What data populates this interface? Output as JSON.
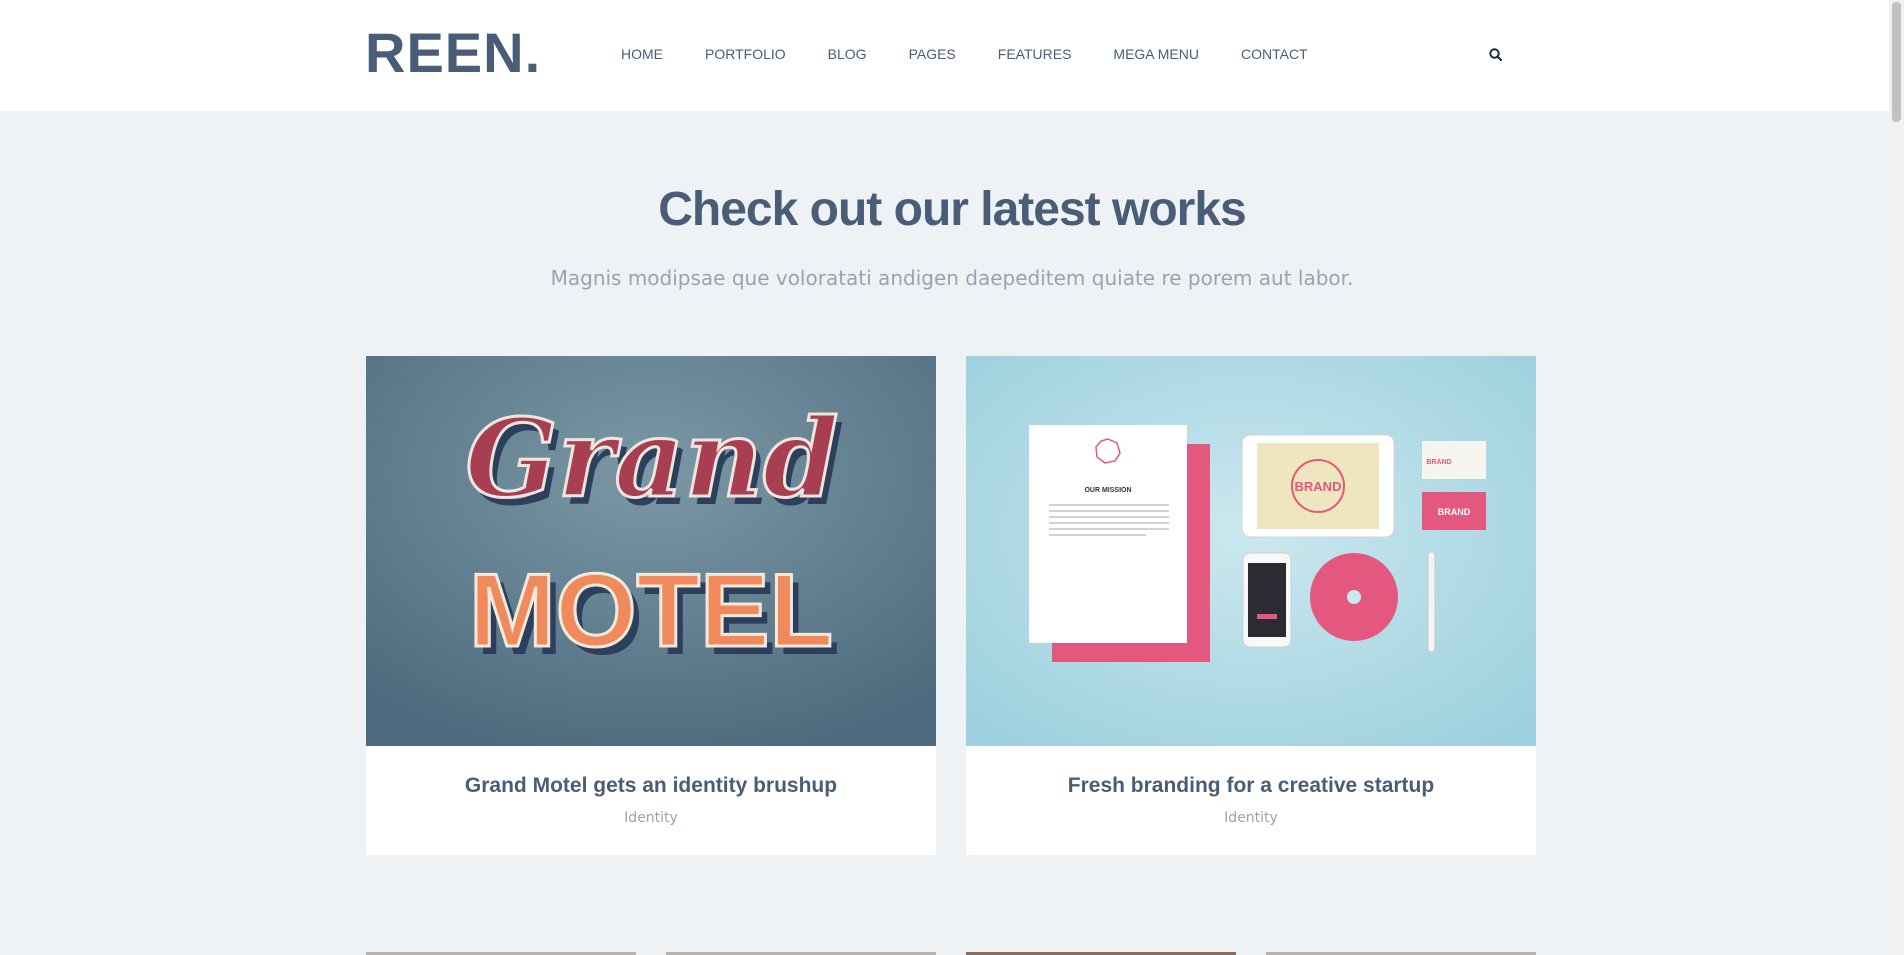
{
  "brand": {
    "logo": "REEN."
  },
  "nav": {
    "items": [
      "HOME",
      "PORTFOLIO",
      "BLOG",
      "PAGES",
      "FEATURES",
      "MEGA MENU",
      "CONTACT"
    ],
    "search_icon": "search-icon"
  },
  "section": {
    "title": "Check out our latest works",
    "subtitle": "Magnis modipsae que voloratati andigen daepeditem quiate re porem aut labor."
  },
  "works": [
    {
      "title": "Grand Motel gets an identity brushup",
      "category": "Identity",
      "image_text": {
        "script": "Grand",
        "block": "MOTEL"
      }
    },
    {
      "title": "Fresh branding for a creative startup",
      "category": "Identity",
      "image_text": {
        "letterhead": "OUR MISSION",
        "brand": "BRAND"
      }
    }
  ],
  "colors": {
    "primary": "#4a5d78",
    "muted": "#97a3b4",
    "page_bg": "#eff2f5",
    "accent_pink": "#e4577f",
    "motel_bg": "#5d7b8d",
    "brand_bg": "#a3d3e0"
  }
}
